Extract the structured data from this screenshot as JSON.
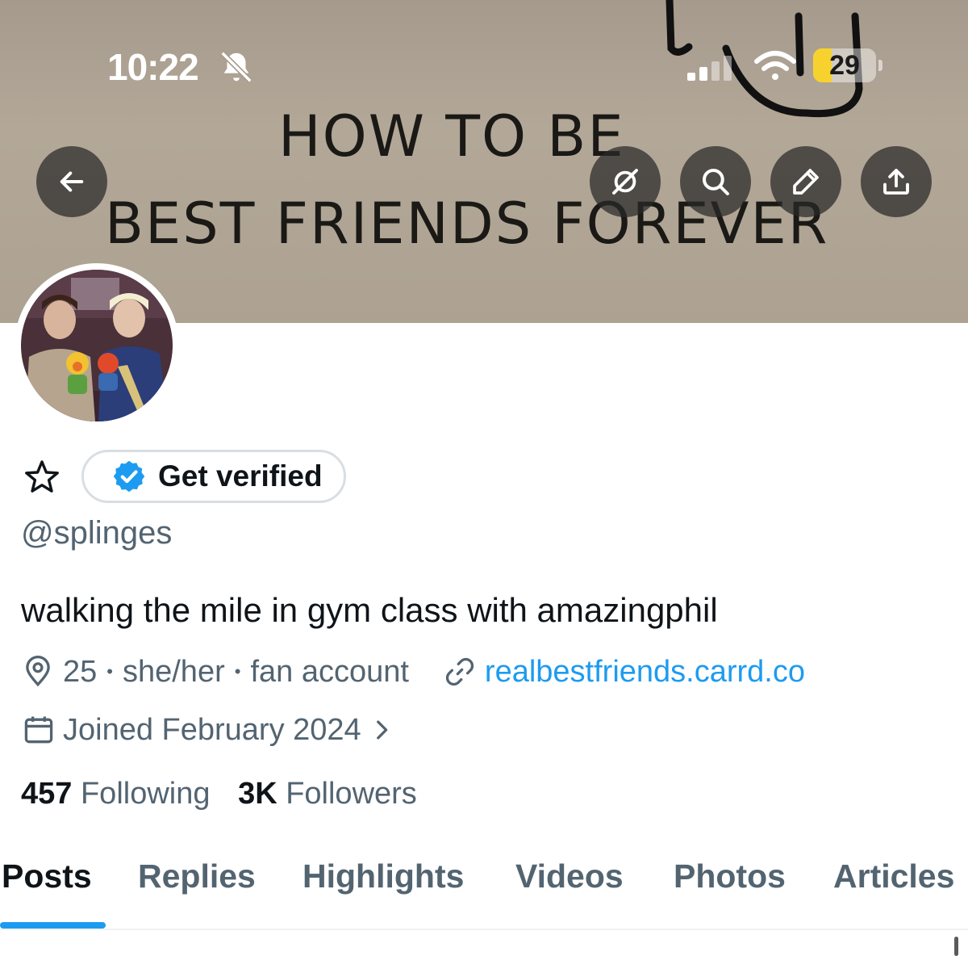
{
  "status_bar": {
    "time": "10:22",
    "battery_percent": "29",
    "battery_level": 0.29,
    "icons": [
      "bell-slash-icon",
      "signal-icon",
      "wifi-icon",
      "battery-icon"
    ]
  },
  "banner": {
    "line1": "HOW TO BE",
    "line2": "BEST FRIENDS FOREVER"
  },
  "header_actions": [
    "back-arrow-icon",
    "grok-icon",
    "search-icon",
    "edit-pencil-icon",
    "share-icon"
  ],
  "profile": {
    "verify_label": "Get verified",
    "handle": "@splinges",
    "bio": "walking the mile in gym class with amazingphil",
    "age": "25",
    "pronouns": "she/her",
    "tag": "fan account",
    "link": "realbestfriends.carrd.co",
    "joined": "Joined February 2024",
    "following_count": "457",
    "following_label": "Following",
    "followers_count": "3K",
    "followers_label": "Followers"
  },
  "tabs": [
    {
      "label": "Posts",
      "active": true
    },
    {
      "label": "Replies",
      "active": false
    },
    {
      "label": "Highlights",
      "active": false
    },
    {
      "label": "Videos",
      "active": false
    },
    {
      "label": "Photos",
      "active": false
    },
    {
      "label": "Articles",
      "active": false
    }
  ],
  "colors": {
    "accent": "#1d9bf0",
    "secondary_text": "#536471",
    "primary_text": "#0f1419",
    "battery_yellow": "#f7d22e"
  }
}
